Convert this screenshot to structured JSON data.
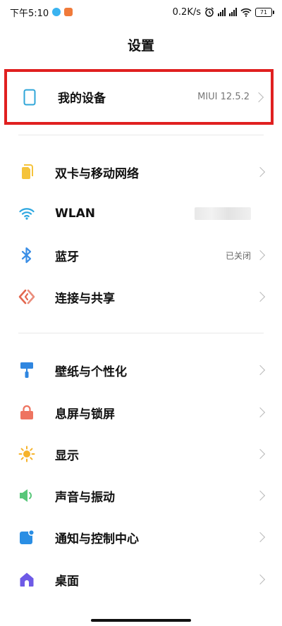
{
  "status": {
    "time": "下午5:10",
    "speed": "0.2K/s",
    "battery": "71"
  },
  "page": {
    "title": "设置"
  },
  "device": {
    "label": "我的设备",
    "value": "MIUI 12.5.2"
  },
  "groups": [
    [
      {
        "id": "dual-sim",
        "label": "双卡与移动网络",
        "value": ""
      },
      {
        "id": "wlan",
        "label": "WLAN",
        "value": ""
      },
      {
        "id": "bluetooth",
        "label": "蓝牙",
        "value": "已关闭"
      },
      {
        "id": "connection",
        "label": "连接与共享",
        "value": ""
      }
    ],
    [
      {
        "id": "wallpaper",
        "label": "壁纸与个性化",
        "value": ""
      },
      {
        "id": "lockscreen",
        "label": "息屏与锁屏",
        "value": ""
      },
      {
        "id": "display",
        "label": "显示",
        "value": ""
      },
      {
        "id": "sound",
        "label": "声音与振动",
        "value": ""
      },
      {
        "id": "notification",
        "label": "通知与控制中心",
        "value": ""
      },
      {
        "id": "desktop",
        "label": "桌面",
        "value": ""
      }
    ]
  ],
  "colors": {
    "highlight": "#e02020",
    "device_icon": "#2fa6d8",
    "dual_sim": "#f5c33b",
    "wlan": "#2ea7e0",
    "bluetooth": "#3a8ee6",
    "connection": "#e3674f",
    "wallpaper": "#2f86e0",
    "lock": "#ee7460",
    "display": "#f6b32c",
    "sound": "#58c779",
    "notification": "#2a8ee4",
    "desktop": "#6e5ae6"
  }
}
